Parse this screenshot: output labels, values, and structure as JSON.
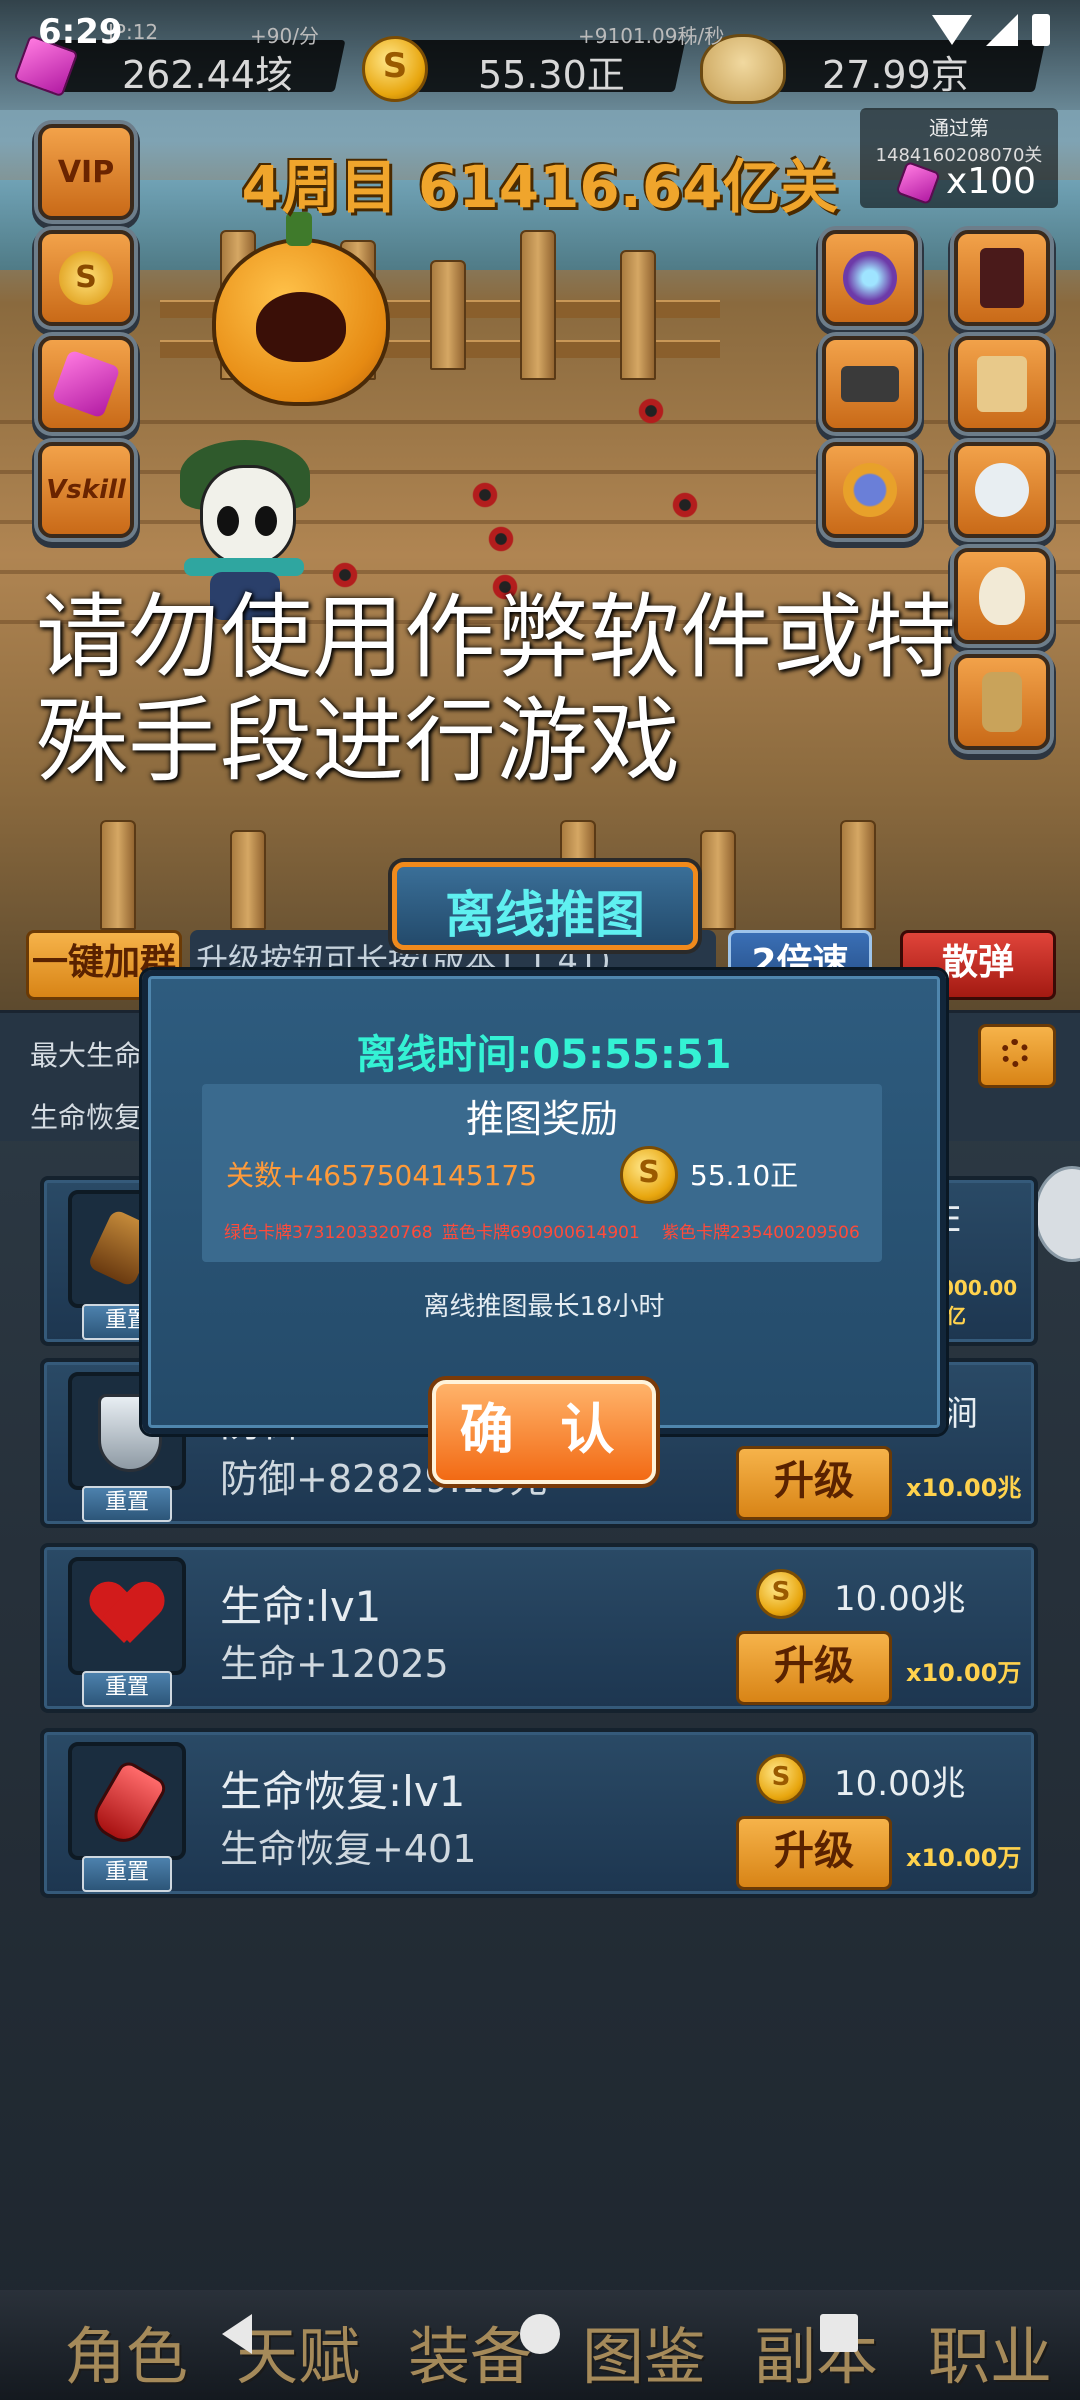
{
  "status_bar": {
    "time": "6:29"
  },
  "resources": {
    "gem": {
      "rate": "IP:12",
      "value": "262.44垓"
    },
    "coin": {
      "rate": "+90/分",
      "value": "55.30正",
      "coin_symbol": "S"
    },
    "skull": {
      "rate": "+9101.09秭/秒",
      "value": "27.99京"
    }
  },
  "stage": {
    "title": "4周目 61416.64亿关"
  },
  "pass_box": {
    "label": "通过第",
    "number": "1484160208070关",
    "count": "x100"
  },
  "side_buttons_left": [
    "VIP",
    "S",
    "gem",
    "Vskill"
  ],
  "warning_text": "请勿使用作弊软件或特殊手段进行游戏",
  "toolbar": {
    "one_key": "一键加群",
    "marquee": "升级按钮可长按(版本1.1.41)",
    "speed": "2倍速",
    "scatter": "散弹"
  },
  "stats": {
    "max_life": "最大生命",
    "life_regen": "生命恢复"
  },
  "popup": {
    "tab_title": "离线推图",
    "offline_label": "离线时间:",
    "offline_time": "05:55:51",
    "reward_title": "推图奖励",
    "levels": "关数+4657504145175",
    "gold": "55.10正",
    "green_card": "绿色卡牌3731203320768",
    "blue_card": "蓝色卡牌690900614901",
    "purple_card": "紫色卡牌235400209506",
    "max_note": "离线推图最长18小时",
    "confirm": "确 认"
  },
  "partial_card": {
    "right_letter": "E",
    "right_cost": "000.00",
    "right_unit": "亿"
  },
  "upgrades": [
    {
      "name": "防御:lv1",
      "desc": "防御+82829.19兆",
      "cost": "涧",
      "mult": "x10.00兆",
      "reset": "重置",
      "btn": "升级"
    },
    {
      "name": "生命:lv1",
      "desc": "生命+12025",
      "cost": "10.00兆",
      "mult": "x10.00万",
      "reset": "重置",
      "btn": "升级"
    },
    {
      "name": "生命恢复:lv1",
      "desc": "生命恢复+401",
      "cost": "10.00兆",
      "mult": "x10.00万",
      "reset": "重置",
      "btn": "升级"
    }
  ],
  "first_card_reset": "重置",
  "nav": [
    "角色",
    "天赋",
    "装备",
    "图鉴",
    "副本",
    "职业"
  ],
  "colors": {
    "accent": "#f0a52c",
    "popup_title": "#34f2d4",
    "reward_orange": "#ff9b3a"
  }
}
